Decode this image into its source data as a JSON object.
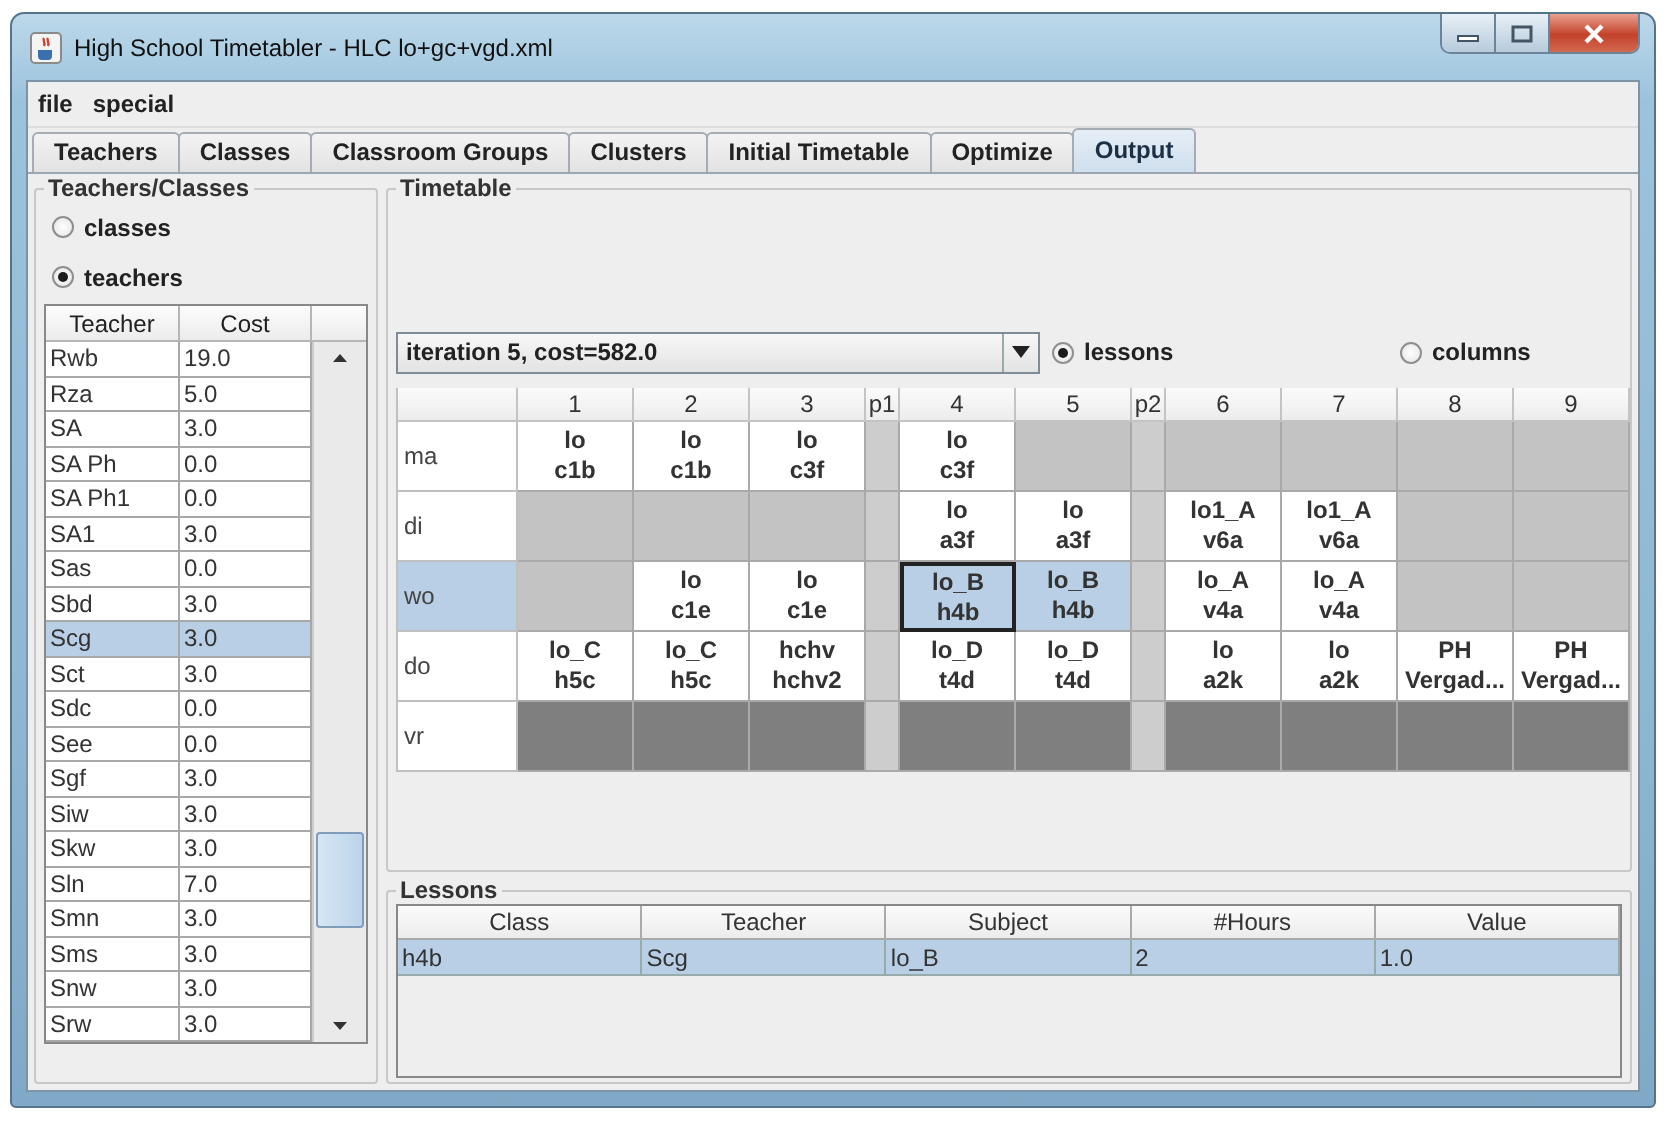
{
  "window": {
    "title": "High School Timetabler - HLC lo+gc+vgd.xml"
  },
  "menu": [
    "file",
    "special"
  ],
  "tabs": [
    {
      "label": "Teachers",
      "selected": false
    },
    {
      "label": "Classes",
      "selected": false
    },
    {
      "label": "Classroom Groups",
      "selected": false
    },
    {
      "label": "Clusters",
      "selected": false
    },
    {
      "label": "Initial Timetable",
      "selected": false
    },
    {
      "label": "Optimize",
      "selected": false
    },
    {
      "label": "Output",
      "selected": true
    }
  ],
  "teachers_classes": {
    "title": "Teachers/Classes",
    "options": [
      {
        "label": "classes",
        "selected": false
      },
      {
        "label": "teachers",
        "selected": true
      }
    ],
    "columns": [
      "Teacher",
      "Cost"
    ],
    "rows": [
      {
        "teacher": "Rwb",
        "cost": "19.0",
        "selected": false
      },
      {
        "teacher": "Rza",
        "cost": "5.0",
        "selected": false
      },
      {
        "teacher": "SA",
        "cost": "3.0",
        "selected": false
      },
      {
        "teacher": "SA Ph",
        "cost": "0.0",
        "selected": false
      },
      {
        "teacher": "SA Ph1",
        "cost": "0.0",
        "selected": false
      },
      {
        "teacher": "SA1",
        "cost": "3.0",
        "selected": false
      },
      {
        "teacher": "Sas",
        "cost": "0.0",
        "selected": false
      },
      {
        "teacher": "Sbd",
        "cost": "3.0",
        "selected": false
      },
      {
        "teacher": "Scg",
        "cost": "3.0",
        "selected": true
      },
      {
        "teacher": "Sct",
        "cost": "3.0",
        "selected": false
      },
      {
        "teacher": "Sdc",
        "cost": "0.0",
        "selected": false
      },
      {
        "teacher": "See",
        "cost": "0.0",
        "selected": false
      },
      {
        "teacher": "Sgf",
        "cost": "3.0",
        "selected": false
      },
      {
        "teacher": "Siw",
        "cost": "3.0",
        "selected": false
      },
      {
        "teacher": "Skw",
        "cost": "3.0",
        "selected": false
      },
      {
        "teacher": "Sln",
        "cost": "7.0",
        "selected": false
      },
      {
        "teacher": "Smn",
        "cost": "3.0",
        "selected": false
      },
      {
        "teacher": "Sms",
        "cost": "3.0",
        "selected": false
      },
      {
        "teacher": "Snw",
        "cost": "3.0",
        "selected": false
      },
      {
        "teacher": "Srw",
        "cost": "3.0",
        "selected": false
      }
    ]
  },
  "timetable": {
    "title": "Timetable",
    "iteration": "iteration 5, cost=582.0",
    "view_options": [
      {
        "label": "lessons",
        "selected": true
      },
      {
        "label": "columns",
        "selected": false
      }
    ],
    "columns": [
      {
        "label": "1",
        "kind": "period"
      },
      {
        "label": "2",
        "kind": "period"
      },
      {
        "label": "3",
        "kind": "period"
      },
      {
        "label": "p1",
        "kind": "pause"
      },
      {
        "label": "4",
        "kind": "period"
      },
      {
        "label": "5",
        "kind": "period"
      },
      {
        "label": "p2",
        "kind": "pause"
      },
      {
        "label": "6",
        "kind": "period"
      },
      {
        "label": "7",
        "kind": "period"
      },
      {
        "label": "8",
        "kind": "period"
      },
      {
        "label": "9",
        "kind": "period"
      }
    ],
    "rows": [
      {
        "day": "ma",
        "selected": false,
        "cells": [
          {
            "kind": "lesson",
            "subject": "lo",
            "group": "c1b",
            "selected": false,
            "focused": false
          },
          {
            "kind": "lesson",
            "subject": "lo",
            "group": "c1b",
            "selected": false,
            "focused": false
          },
          {
            "kind": "lesson",
            "subject": "lo",
            "group": "c3f",
            "selected": false,
            "focused": false
          },
          {
            "kind": "pause"
          },
          {
            "kind": "lesson",
            "subject": "lo",
            "group": "c3f",
            "selected": false,
            "focused": false
          },
          {
            "kind": "free"
          },
          {
            "kind": "pause"
          },
          {
            "kind": "free"
          },
          {
            "kind": "free"
          },
          {
            "kind": "free"
          },
          {
            "kind": "free"
          }
        ]
      },
      {
        "day": "di",
        "selected": false,
        "cells": [
          {
            "kind": "free"
          },
          {
            "kind": "free"
          },
          {
            "kind": "free"
          },
          {
            "kind": "pause"
          },
          {
            "kind": "lesson",
            "subject": "lo",
            "group": "a3f",
            "selected": false,
            "focused": false
          },
          {
            "kind": "lesson",
            "subject": "lo",
            "group": "a3f",
            "selected": false,
            "focused": false
          },
          {
            "kind": "pause"
          },
          {
            "kind": "lesson",
            "subject": "lo1_A",
            "group": "v6a",
            "selected": false,
            "focused": false
          },
          {
            "kind": "lesson",
            "subject": "lo1_A",
            "group": "v6a",
            "selected": false,
            "focused": false
          },
          {
            "kind": "free"
          },
          {
            "kind": "free"
          }
        ]
      },
      {
        "day": "wo",
        "selected": true,
        "cells": [
          {
            "kind": "free"
          },
          {
            "kind": "lesson",
            "subject": "lo",
            "group": "c1e",
            "selected": false,
            "focused": false
          },
          {
            "kind": "lesson",
            "subject": "lo",
            "group": "c1e",
            "selected": false,
            "focused": false
          },
          {
            "kind": "pause"
          },
          {
            "kind": "lesson",
            "subject": "lo_B",
            "group": "h4b",
            "selected": true,
            "focused": true
          },
          {
            "kind": "lesson",
            "subject": "lo_B",
            "group": "h4b",
            "selected": true,
            "focused": false
          },
          {
            "kind": "pause"
          },
          {
            "kind": "lesson",
            "subject": "lo_A",
            "group": "v4a",
            "selected": false,
            "focused": false
          },
          {
            "kind": "lesson",
            "subject": "lo_A",
            "group": "v4a",
            "selected": false,
            "focused": false
          },
          {
            "kind": "free"
          },
          {
            "kind": "free"
          }
        ]
      },
      {
        "day": "do",
        "selected": false,
        "cells": [
          {
            "kind": "lesson",
            "subject": "lo_C",
            "group": "h5c",
            "selected": false,
            "focused": false
          },
          {
            "kind": "lesson",
            "subject": "lo_C",
            "group": "h5c",
            "selected": false,
            "focused": false
          },
          {
            "kind": "lesson",
            "subject": "hchv",
            "group": "hchv2",
            "selected": false,
            "focused": false
          },
          {
            "kind": "pause"
          },
          {
            "kind": "lesson",
            "subject": "lo_D",
            "group": "t4d",
            "selected": false,
            "focused": false
          },
          {
            "kind": "lesson",
            "subject": "lo_D",
            "group": "t4d",
            "selected": false,
            "focused": false
          },
          {
            "kind": "pause"
          },
          {
            "kind": "lesson",
            "subject": "lo",
            "group": "a2k",
            "selected": false,
            "focused": false
          },
          {
            "kind": "lesson",
            "subject": "lo",
            "group": "a2k",
            "selected": false,
            "focused": false
          },
          {
            "kind": "lesson",
            "subject": "PH",
            "group": "Vergad...",
            "selected": false,
            "focused": false
          },
          {
            "kind": "lesson",
            "subject": "PH",
            "group": "Vergad...",
            "selected": false,
            "focused": false
          }
        ]
      },
      {
        "day": "vr",
        "selected": false,
        "cells": [
          {
            "kind": "closed"
          },
          {
            "kind": "closed"
          },
          {
            "kind": "closed"
          },
          {
            "kind": "pause"
          },
          {
            "kind": "closed"
          },
          {
            "kind": "closed"
          },
          {
            "kind": "pause"
          },
          {
            "kind": "closed"
          },
          {
            "kind": "closed"
          },
          {
            "kind": "closed"
          },
          {
            "kind": "closed"
          }
        ]
      }
    ]
  },
  "lessons": {
    "title": "Lessons",
    "columns": [
      "Class",
      "Teacher",
      "Subject",
      "#Hours",
      "Value"
    ],
    "rows": [
      {
        "cells": [
          "h4b",
          "Scg",
          "lo_B",
          "2",
          "1.0"
        ],
        "selected": true
      }
    ]
  }
}
